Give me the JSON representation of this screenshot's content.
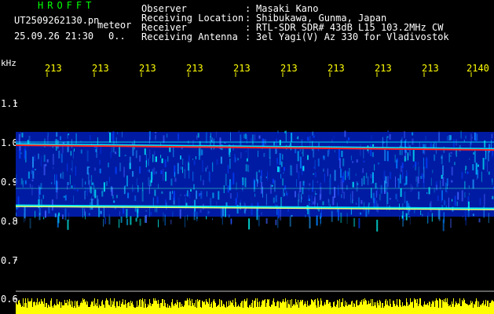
{
  "header": {
    "app_title": "HROFFT",
    "file_name": "UT2509262130.pn",
    "mode": "meteor",
    "date_time": "25.09.26 21:30",
    "status": "0..",
    "info": [
      {
        "label": "Observer",
        "value": "Masaki Kano"
      },
      {
        "label": "Receiving Location",
        "value": "Shibukawa, Gunma, Japan"
      },
      {
        "label": "Receiver",
        "value": "RTL-SDR SDR# 43dB L15 103.2MHz CW"
      },
      {
        "label": "Receiving Antenna",
        "value": "3el Yagi(V) Az 330 for Vladivostok"
      }
    ]
  },
  "axis": {
    "unit": "kHz",
    "x_ticks": [
      "213",
      "213",
      "213",
      "213",
      "213",
      "213",
      "213",
      "213",
      "213",
      "2140"
    ],
    "y_ticks": [
      "1.1",
      "1.0",
      "0.9",
      "0.8",
      "0.7",
      "0.6"
    ]
  },
  "colors": {
    "background": "#000000",
    "header_text": "#ffffff",
    "title_text": "#00ff00",
    "tick_text": "#ffff00",
    "signal_strong": "#ff2020",
    "signal_mid": "#00ffff",
    "noise": "#0020c0",
    "power_bar": "#ffff00"
  }
}
